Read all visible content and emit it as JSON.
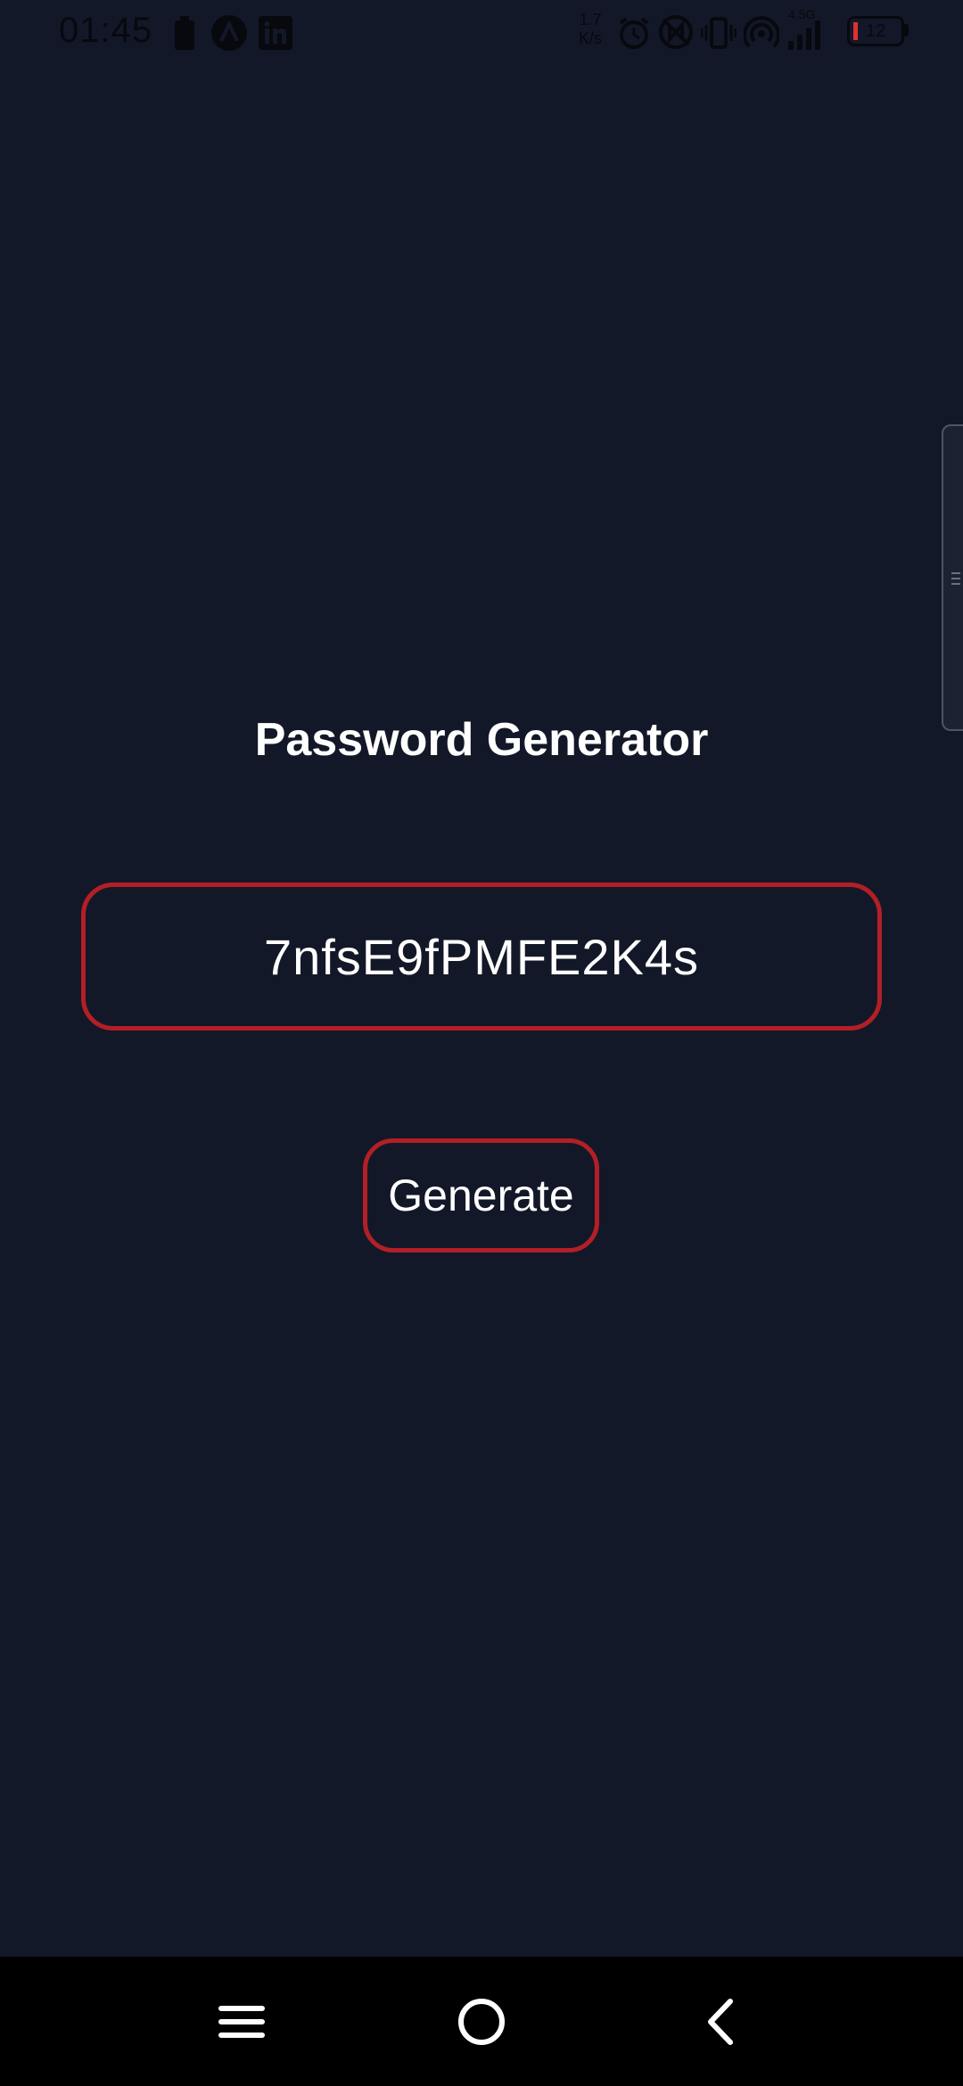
{
  "status_bar": {
    "time": "01:45",
    "net_speed_value": "1.7",
    "net_speed_unit": "K/s",
    "network_type": "4.5G",
    "battery_level": "12",
    "icons": [
      "battery-saver-icon",
      "app-a-icon",
      "linkedin-icon",
      "alarm-icon",
      "nfc-icon",
      "vibrate-icon",
      "hotspot-icon",
      "signal-icon",
      "battery-icon"
    ]
  },
  "main": {
    "title": "Password Generator",
    "password": "7nfsE9fPMFE2K4s",
    "generate_label": "Generate"
  },
  "nav_bar": {
    "icons": [
      "menu-icon",
      "home-icon",
      "back-icon"
    ]
  },
  "colors": {
    "background": "#131828",
    "accent_border": "#b31f26",
    "text": "#ffffff",
    "nav_background": "#000000"
  }
}
